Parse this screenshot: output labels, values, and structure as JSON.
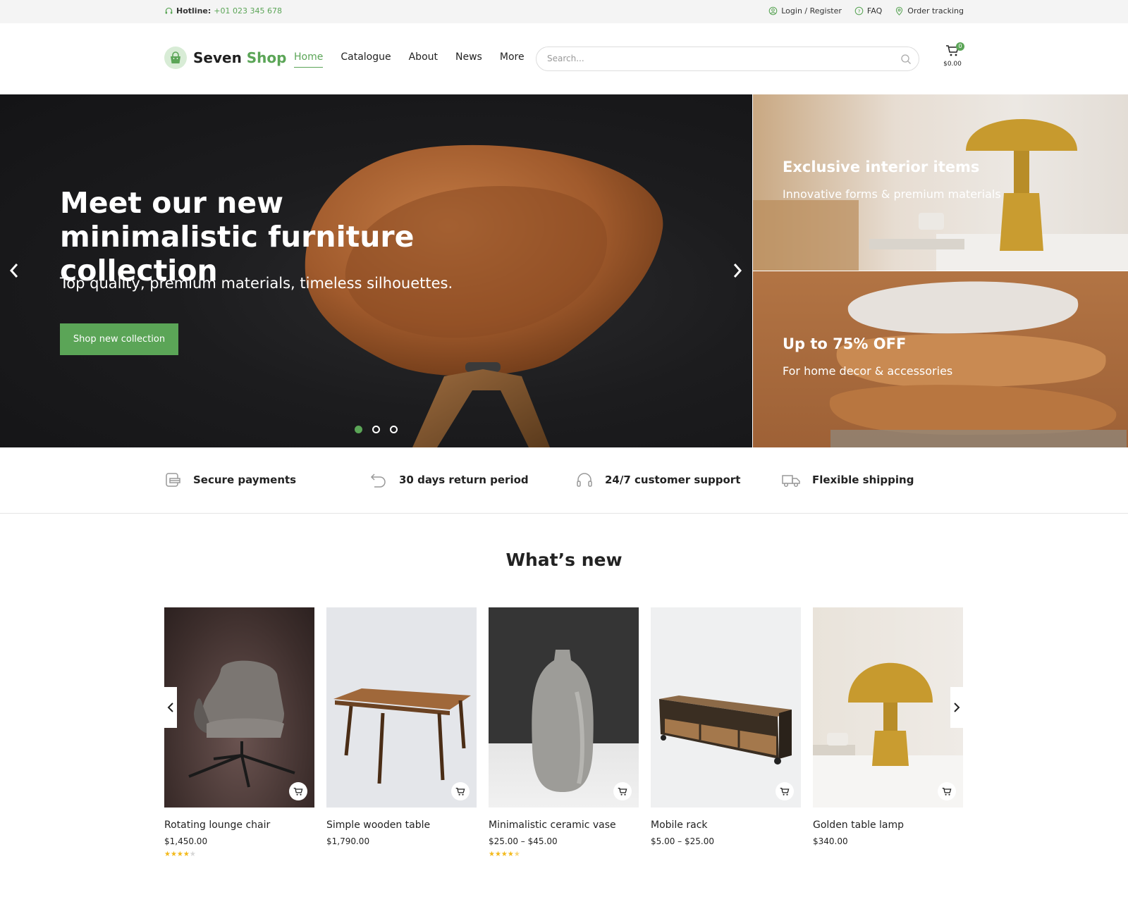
{
  "topbar": {
    "hotline_label": "Hotline:",
    "hotline_number": "+01 023 345 678",
    "links": [
      "Login / Register",
      "FAQ",
      "Order tracking"
    ]
  },
  "header": {
    "logo_word1": "Seven",
    "logo_word2": "Shop",
    "nav": [
      "Home",
      "Catalogue",
      "About",
      "News",
      "More"
    ],
    "active_nav": "Home",
    "search_placeholder": "Search...",
    "cart_count": "0",
    "cart_total": "$0.00"
  },
  "hero": {
    "title": "Meet our new minimalistic furniture collection",
    "subtitle": "Top quality, premium materials, timeless silhouettes.",
    "button": "Shop new collection",
    "prev_icon": "chevron-left-icon",
    "next_icon": "chevron-right-icon",
    "slide_count": 3,
    "active_slide": 1
  },
  "banners": [
    {
      "title": "Exclusive interior items",
      "subtitle": "Innovative forms & premium materials"
    },
    {
      "title": "Up to 75% OFF",
      "subtitle": "For home decor & accessories"
    }
  ],
  "features": [
    {
      "label": "Secure payments",
      "icon": "card-icon"
    },
    {
      "label": "30 days return period",
      "icon": "return-icon"
    },
    {
      "label": "24/7 customer support",
      "icon": "headset-icon"
    },
    {
      "label": "Flexible shipping",
      "icon": "truck-icon"
    }
  ],
  "whats_new": {
    "title": "What’s new",
    "products": [
      {
        "name": "Rotating lounge chair",
        "price": "$1,450.00",
        "rating": 4
      },
      {
        "name": "Simple wooden table",
        "price": "$1,790.00",
        "rating": 0
      },
      {
        "name": "Minimalistic ceramic vase",
        "price": "$25.00 – $45.00",
        "rating": 4.5
      },
      {
        "name": "Mobile rack",
        "price": "$5.00 – $25.00",
        "rating": 0
      },
      {
        "name": "Golden table lamp",
        "price": "$340.00",
        "rating": 0
      }
    ]
  },
  "colors": {
    "accent": "#5ba557",
    "star": "#f3b91a",
    "hero_bg": "#1c1c1e"
  }
}
